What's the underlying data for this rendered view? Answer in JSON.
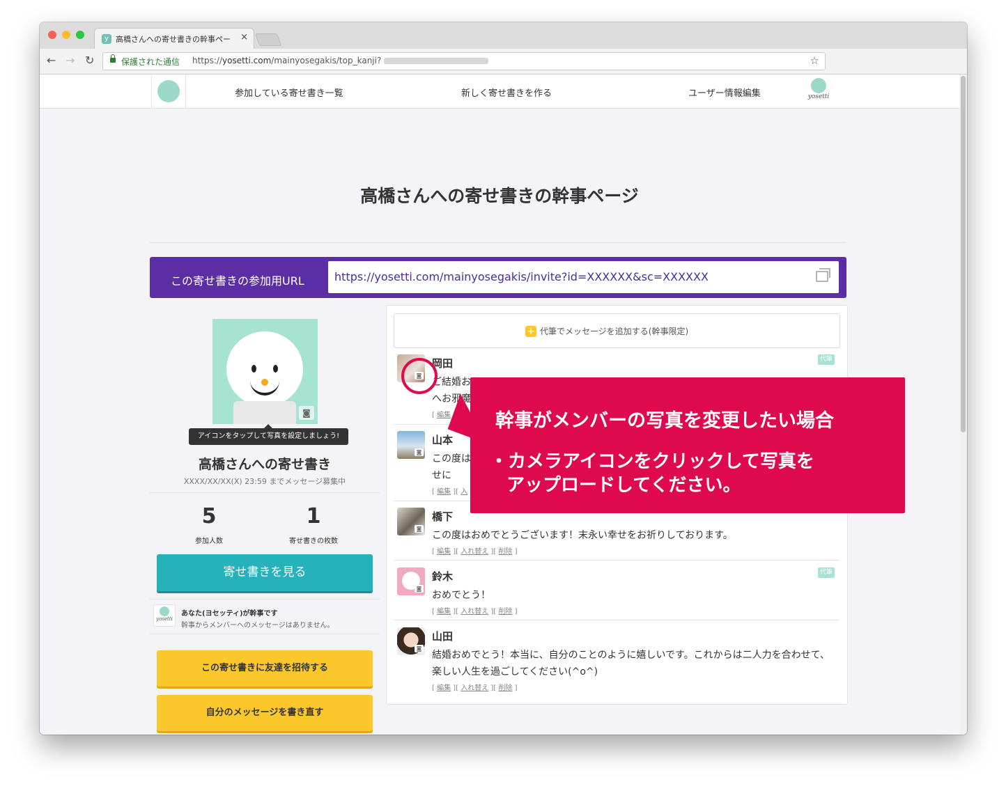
{
  "browser": {
    "tab_title": "高橋さんへの寄せ書きの幹事ペー",
    "favicon_letter": "y",
    "secure_label": "保護された通信",
    "url_scheme": "https://",
    "url_host": "yosetti.com",
    "url_path": "/mainyosegakis/top_kanji?"
  },
  "nav": {
    "items": [
      "参加している寄せ書き一覧",
      "新しく寄せ書きを作る",
      "ユーザー情報編集"
    ],
    "brand": "yosetti"
  },
  "page": {
    "title": "高橋さんへの寄せ書きの幹事ページ",
    "invite_label": "この寄せ書きの参加用URL",
    "invite_url": "https://yosetti.com/mainyosegakis/invite?id=XXXXXX&sc=XXXXXX"
  },
  "left": {
    "tooltip": "アイコンをタップして写真を設定しましょう!",
    "yosegaki_title": "高橋さんへの寄せ書き",
    "deadline": "XXXX/XX/XX(X) 23:59 までメッセージ募集中",
    "stat_participants_value": "5",
    "stat_participants_label": "参加人数",
    "stat_cards_value": "1",
    "stat_cards_label": "寄せ書きの枚数",
    "view_button": "寄せ書きを見る",
    "kanji_logo": "yosetti",
    "kanji_line1": "あなた(ヨセッティ)が幹事です",
    "kanji_line2": "幹事からメンバーへのメッセージはありません。",
    "invite_button": "この寄せ書きに友達を招待する",
    "rewrite_button": "自分のメッセージを書き直す"
  },
  "right": {
    "add_button": "代筆でメッセージを追加する(幹事限定)",
    "proxy_label": "代筆",
    "link_edit": "編集",
    "link_swap": "入れ替え",
    "link_delete": "削除",
    "messages": [
      {
        "name": "岡田",
        "body": "ご結婚お",
        "body2": "へお邪魔"
      },
      {
        "name": "山本",
        "body": "この度は",
        "body2": "せに"
      },
      {
        "name": "橋下",
        "body": "この度はおめでとうございます！末永い幸せをお祈りしております。"
      },
      {
        "name": "鈴木",
        "body": "おめでとう！"
      },
      {
        "name": "山田",
        "body": "結婚おめでとう！本当に、自分のことのように嬉しいです。これからは二人力を合わせて、楽しい人生を過ごしてください(^o^)"
      }
    ]
  },
  "callout": {
    "title": "幹事がメンバーの写真を変更したい場合",
    "bullet1": "・カメラアイコンをクリックして写真を",
    "bullet2": "アップロードしてください。"
  }
}
